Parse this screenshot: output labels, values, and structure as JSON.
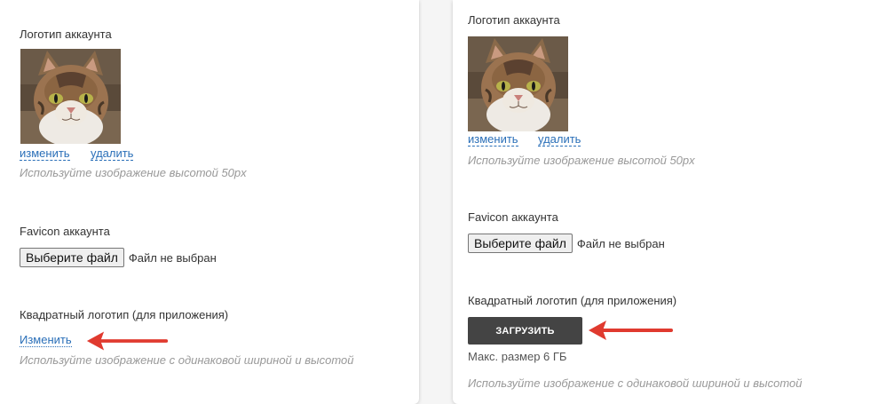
{
  "left": {
    "logo_label": "Логотип аккаунта",
    "change_link": "изменить",
    "delete_link": "удалить",
    "logo_hint": "Используйте изображение высотой 50px",
    "favicon_label": "Favicon аккаунта",
    "file_button": "Выберите файл",
    "file_status": "Файл не выбран",
    "square_logo_label": "Квадратный логотип (для приложения)",
    "square_change_link": "Изменить",
    "square_hint": "Используйте изображение с одинаковой шириной и высотой"
  },
  "right": {
    "logo_label": "Логотип аккаунта",
    "change_link": "изменить",
    "delete_link": "удалить",
    "logo_hint": "Используйте изображение высотой 50px",
    "favicon_label": "Favicon аккаунта",
    "file_button": "Выберите файл",
    "file_status": "Файл не выбран",
    "square_logo_label": "Квадратный логотип (для приложения)",
    "upload_button": "ЗАГРУЗИТЬ",
    "max_size": "Макс. размер 6 ГБ",
    "square_hint": "Используйте изображение с одинаковой шириной и высотой"
  },
  "colors": {
    "link": "#2a6fb8",
    "arrow": "#e03a2f",
    "upload_button_bg": "#444444"
  },
  "icons": {
    "avatar": "cat-photo",
    "annotation": "red-arrow-left"
  }
}
